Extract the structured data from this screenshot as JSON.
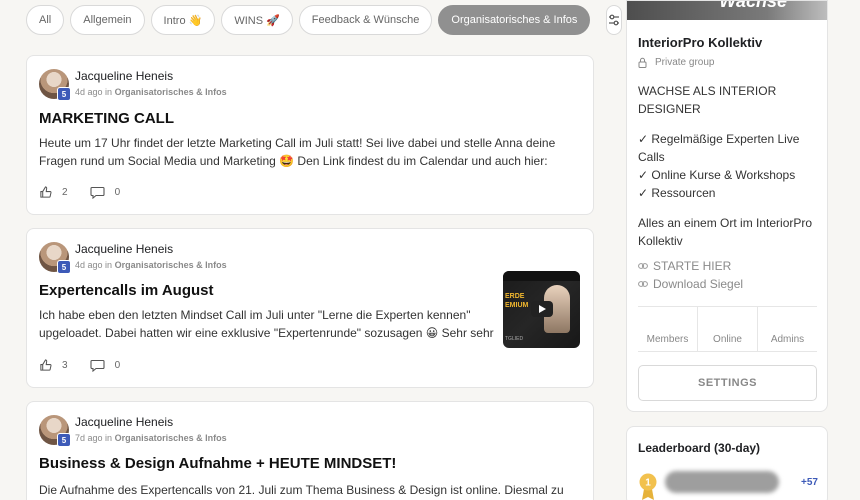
{
  "filters": {
    "chips": [
      "All",
      "Allgemein",
      "Intro 👋",
      "WINS 🚀",
      "Feedback & Wünsche",
      "Organisatorisches & Infos"
    ],
    "active": "Organisatorisches & Infos"
  },
  "posts": [
    {
      "author": "Jacqueline Heneis",
      "level": "5",
      "time": "4d ago",
      "in": "in",
      "category": "Organisatorisches & Infos",
      "title": "MARKETING CALL",
      "body_lines": [
        "Heute um 17 Uhr findet der letzte Marketing Call im Juli statt! Sei live dabei und stelle Anna deine",
        "Fragen rund um Social Media und Marketing 🤩 Den Link findest du im Calendar und auch hier:"
      ],
      "likes": "2",
      "comments": "0"
    },
    {
      "author": "Jacqueline Heneis",
      "level": "5",
      "time": "4d ago",
      "in": "in",
      "category": "Organisatorisches & Infos",
      "title": "Expertencalls im August",
      "body_lines": [
        "Ich habe eben den letzten Mindset Call im Juli unter \"Lerne die Experten kennen\"",
        "upgeloadet. Dabei hatten wir eine exklusive \"Expertenrunde\" sozusagen 😀 Sehr sehr"
      ],
      "likes": "3",
      "comments": "0",
      "thumbnail": {
        "line1": "ERDE",
        "line2": "EMIUM",
        "line3": "TGLIED"
      }
    },
    {
      "author": "Jacqueline Heneis",
      "level": "5",
      "time": "7d ago",
      "in": "in",
      "category": "Organisatorisches & Infos",
      "title": "Business & Design Aufnahme + HEUTE MINDSET!",
      "body_lines": [
        "Die Aufnahme des Expertencalls von 21. Juli zum Thema Business & Design ist online. Diesmal zu"
      ]
    }
  ],
  "group": {
    "cover_text": "Wachse",
    "name": "InteriorPro Kollektiv",
    "privacy": "Private group",
    "tagline_lines": [
      "WACHSE ALS INTERIOR",
      "DESIGNER"
    ],
    "bullets": [
      "✓ Regelmäßige Experten Live",
      "Calls",
      "✓ Online Kurse & Workshops",
      "✓ Ressourcen"
    ],
    "summary_lines": [
      "Alles an einem Ort im InteriorPro",
      "Kollektiv"
    ],
    "links": [
      "STARTE HIER",
      "Download Siegel"
    ],
    "stats": [
      "Members",
      "Online",
      "Admins"
    ],
    "settings_label": "SETTINGS"
  },
  "leaderboard": {
    "title": "Leaderboard (30-day)",
    "rank": "1",
    "points": "+57"
  },
  "colors": {
    "accent_blue": "#3d5ab8",
    "active_chip": "#909090",
    "medal_gold": "#f2c14e"
  }
}
